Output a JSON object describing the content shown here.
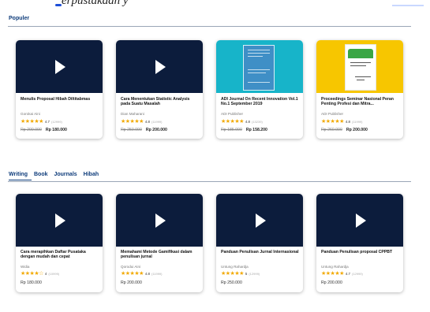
{
  "top_fragment": "erpustakaan y",
  "popular": {
    "title": "Populer",
    "cards": [
      {
        "title": "Menulis Proposal Hibah Diltitabmas",
        "author": "Gorokai Aini",
        "stars": "★★★★★",
        "rating": "4.7",
        "reviews": "(12999)",
        "old_price": "Rp 200.000",
        "price": "Rp 180.000",
        "thumb": "video"
      },
      {
        "title": "Cara Menentukan Statistic Analysis pada Suatu Masalah",
        "author": "Dian Maharani",
        "stars": "★★★★★",
        "rating": "4.8",
        "reviews": "(11999)",
        "old_price": "Rp 250.000",
        "price": "Rp 200.000",
        "thumb": "video"
      },
      {
        "title": "ADI Journal On Recent Innovation Vol.1 No.1 September 2019",
        "author": "ADI Publisher",
        "stars": "★★★★★",
        "rating": "4.8",
        "reviews": "(13239)",
        "old_price": "Rp 185.000",
        "price": "Rp 158.200",
        "thumb": "journal"
      },
      {
        "title": "Proceedings Seminar Nasional Peran Penting Profesi dan Mitra...",
        "author": "ADI Publisher",
        "stars": "★★★★★",
        "rating": "4.8",
        "reviews": "(11999)",
        "old_price": "Rp 260.000",
        "price": "Rp 200.000",
        "thumb": "proceedings"
      }
    ]
  },
  "tabs": [
    "Writing",
    "Book",
    "Journals",
    "Hibah"
  ],
  "writing": {
    "cards": [
      {
        "title": "Cara merapihkan Daftar Pusataka dengan mudah dan cepat",
        "author": "Widia",
        "stars": "★★★★☆",
        "rating": "4",
        "reviews": "(10999)",
        "price": "Rp 180.000"
      },
      {
        "title": "Memahami Metode Gamifikasi dalam penulisan jurnal",
        "author": "Qorodui Aini",
        "stars": "★★★★★",
        "rating": "4.8",
        "reviews": "(11999)",
        "price": "Rp 200.000"
      },
      {
        "title": "Panduan Penulisan Jurnal Internasional",
        "author": "Untung Rahardja",
        "stars": "★★★★★",
        "rating": "5",
        "reviews": "(12999)",
        "price": "Rp 250.000"
      },
      {
        "title": "Panduan Penulisan proposal CPPBT",
        "author": "Untung Rahardja",
        "stars": "★★★★★",
        "rating": "4.7",
        "reviews": "(12999)",
        "price": "Rp 200.000"
      }
    ]
  }
}
